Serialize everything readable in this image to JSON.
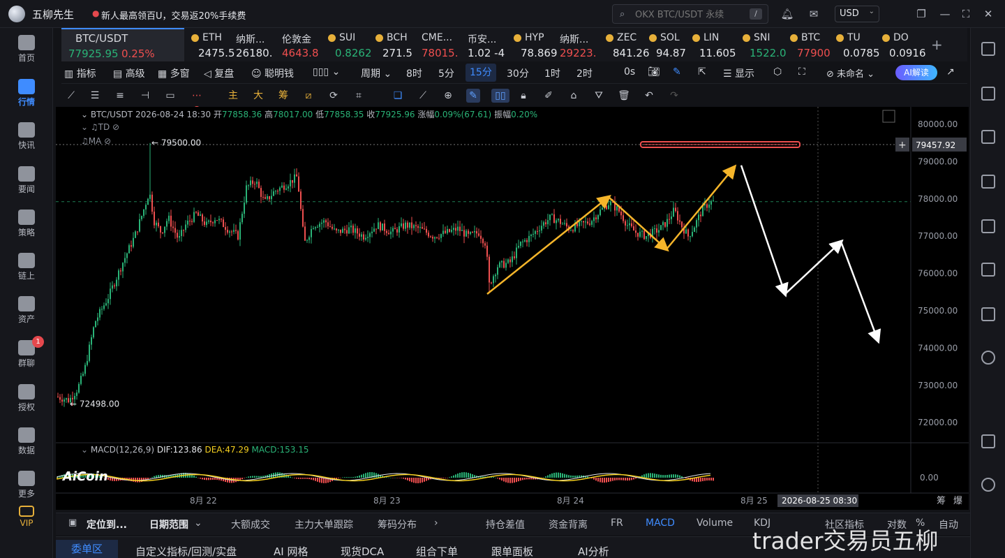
{
  "app": {
    "name": "五柳先生",
    "promo": "新人最高领百U，交易返20%手续费"
  },
  "search": {
    "placeholder": "OKX BTC/USDT 永续",
    "hotkey": "/"
  },
  "currency": "USD",
  "sidebar": {
    "items": [
      {
        "label": "首页",
        "icon": "home-icon"
      },
      {
        "label": "行情",
        "icon": "market-chart-icon",
        "active": true
      },
      {
        "label": "快讯",
        "icon": "flash-news-icon"
      },
      {
        "label": "要闻",
        "icon": "news-icon"
      },
      {
        "label": "策略",
        "icon": "strategy-icon"
      },
      {
        "label": "链上",
        "icon": "onchain-icon"
      },
      {
        "label": "资产",
        "icon": "wallet-icon"
      },
      {
        "label": "群聊",
        "icon": "chat-icon",
        "badge": "1"
      },
      {
        "label": "授权",
        "icon": "key-icon"
      },
      {
        "label": "数据",
        "icon": "data-icon"
      },
      {
        "label": "更多",
        "icon": "more-icon"
      },
      {
        "label": "VIP",
        "icon": "vip-diamond-icon"
      }
    ]
  },
  "tickers": [
    {
      "name": "BTC/USDT",
      "price": "77925.95",
      "change": "0.25%",
      "dir": "up"
    },
    {
      "name": "ETH",
      "price": "2475.5",
      "dir": "neutral"
    },
    {
      "name": "纳斯...",
      "price": "26180.",
      "dir": "neutral"
    },
    {
      "name": "伦敦金",
      "price": "4643.8",
      "dir": "down"
    },
    {
      "name": "SUI",
      "price": "0.8262",
      "dir": "up"
    },
    {
      "name": "BCH",
      "price": "271.5",
      "dir": "neutral"
    },
    {
      "name": "CME...",
      "price": "78015.",
      "dir": "down"
    },
    {
      "name": "币安...",
      "price": "1.02 -4",
      "dir": "neutral"
    },
    {
      "name": "HYP",
      "price": "78.869",
      "dir": "neutral"
    },
    {
      "name": "纳斯...",
      "price": "29223.",
      "dir": "down"
    },
    {
      "name": "ZEC",
      "price": "841.26",
      "dir": "neutral"
    },
    {
      "name": "SOL",
      "price": "94.87",
      "dir": "neutral"
    },
    {
      "name": "LIN",
      "price": "11.605",
      "dir": "neutral"
    },
    {
      "name": "SNI",
      "price": "1522.0",
      "dir": "up"
    },
    {
      "name": "BTC",
      "price": "77900",
      "dir": "down"
    },
    {
      "name": "TU",
      "price": "0.0785",
      "dir": "neutral"
    },
    {
      "name": "DO",
      "price": "0.0916",
      "dir": "neutral"
    }
  ],
  "toolbar": {
    "indicators": "指标",
    "advanced": "高级",
    "multiwindow": "多窗",
    "replay": "复盘",
    "smart_money": "聪明钱",
    "period": "周期",
    "intervals": [
      "8时",
      "5分",
      "15分",
      "30分",
      "1时",
      "2时"
    ],
    "selected_interval": "15分",
    "countdown": "0s",
    "display": "显示",
    "unnamed": "未命名",
    "ai": "AI解读"
  },
  "drawbar": {
    "main": "主",
    "big": "大",
    "chips": "筹"
  },
  "chart": {
    "symbol": "BTC/USDT",
    "datetime": "2026-08-24 18:30",
    "open_label": "开",
    "open": "77858.36",
    "high_label": "高",
    "high": "78017.00",
    "low_label": "低",
    "low": "77858.35",
    "close_label": "收",
    "close": "77925.96",
    "change_label": "涨幅",
    "change": "0.09%(67.61)",
    "amp_label": "振幅",
    "amp": "0.20%",
    "ind_td": "TD",
    "ind_ma": "MA",
    "max_label": "← 79500.00",
    "min_label": "← 72498.00",
    "price_axis": [
      "80000.00",
      "79000.00",
      "78000.00",
      "77000.00",
      "76000.00",
      "75000.00",
      "74000.00",
      "73000.00",
      "72000.00"
    ],
    "crosshair_price": "79457.92",
    "macd_title": "MACD(12,26,9)",
    "dif_label": "DIF:",
    "dif": "123.86",
    "dea_label": "DEA:",
    "dea": "47.29",
    "macd_label": "MACD:",
    "macd": "153.15",
    "macd_axis": "0.00",
    "date_axis": [
      "8月 22",
      "8月 23",
      "8月 24",
      "8月 25"
    ],
    "crosshair_date": "2026-08-25 08:30",
    "logo": "AiCoin",
    "colors": {
      "up": "#2ab377",
      "down": "#ef4f4f",
      "arrow_yellow": "#f5b52a",
      "arrow_white": "#ffffff"
    }
  },
  "bottom1": {
    "locate": "定位到...",
    "range": "日期范围",
    "items": [
      "大额成交",
      "主力大单跟踪",
      "筹码分布",
      "持仓差值",
      "资金背离",
      "FR",
      "MACD",
      "Volume",
      "KDJ",
      "社区指标",
      "对数",
      "%",
      "自动"
    ],
    "selected": "MACD",
    "corner": [
      "筹",
      "爆"
    ]
  },
  "bottom2": {
    "items": [
      "委单区",
      "自定义指标/回测/实盘",
      "AI 网格",
      "现货DCA",
      "组合下单",
      "跟单面板",
      "AI分析"
    ],
    "selected": "委单区"
  },
  "watermark": "trader交易员五柳"
}
